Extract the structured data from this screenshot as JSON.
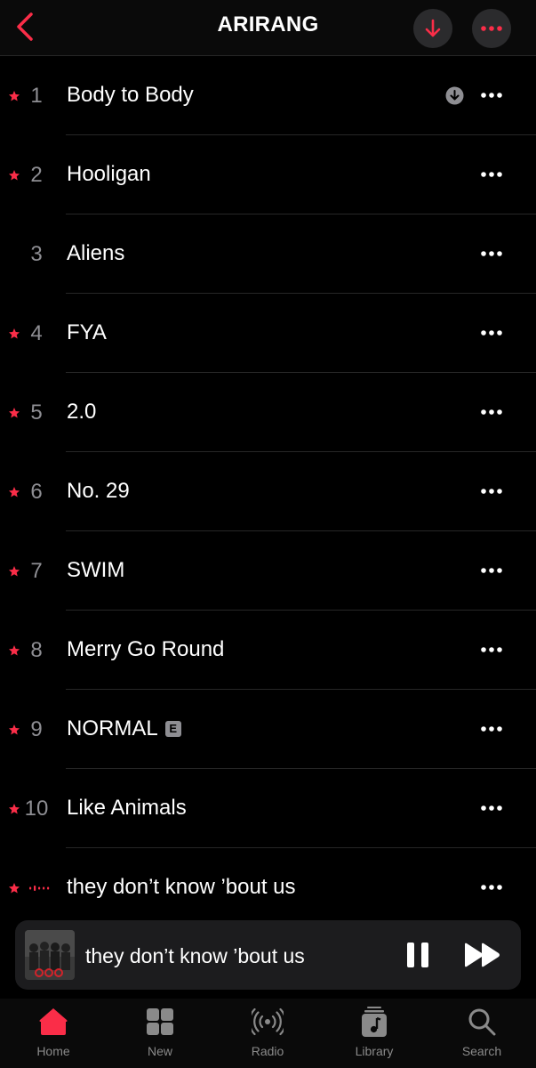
{
  "header": {
    "title": "ARIRANG",
    "back_icon": "chevron-left-icon",
    "download_icon": "arrow-down-icon",
    "more_icon": "ellipsis-icon"
  },
  "colors": {
    "accent": "#fa2d48",
    "secondary_text": "#8e8e93",
    "background": "#000000",
    "surface": "#1c1c1e"
  },
  "tracks": [
    {
      "num": "1",
      "name": "Body to Body",
      "starred": true,
      "downloaded": true,
      "explicit": false,
      "playing": false
    },
    {
      "num": "2",
      "name": "Hooligan",
      "starred": true,
      "downloaded": false,
      "explicit": false,
      "playing": false
    },
    {
      "num": "3",
      "name": "Aliens",
      "starred": false,
      "downloaded": false,
      "explicit": false,
      "playing": false
    },
    {
      "num": "4",
      "name": "FYA",
      "starred": true,
      "downloaded": false,
      "explicit": false,
      "playing": false
    },
    {
      "num": "5",
      "name": "2.0",
      "starred": true,
      "downloaded": false,
      "explicit": false,
      "playing": false
    },
    {
      "num": "6",
      "name": "No. 29",
      "starred": true,
      "downloaded": false,
      "explicit": false,
      "playing": false
    },
    {
      "num": "7",
      "name": "SWIM",
      "starred": true,
      "downloaded": false,
      "explicit": false,
      "playing": false
    },
    {
      "num": "8",
      "name": "Merry Go Round",
      "starred": true,
      "downloaded": false,
      "explicit": false,
      "playing": false
    },
    {
      "num": "9",
      "name": "NORMAL",
      "starred": true,
      "downloaded": false,
      "explicit": true,
      "playing": false
    },
    {
      "num": "10",
      "name": "Like Animals",
      "starred": true,
      "downloaded": false,
      "explicit": false,
      "playing": false
    },
    {
      "num": "",
      "name": "they don’t know ’bout us",
      "starred": true,
      "downloaded": false,
      "explicit": false,
      "playing": true
    }
  ],
  "explicit_badge": "E",
  "mini_player": {
    "title": "they don’t know ’bout us",
    "pause_icon": "pause-icon",
    "forward_icon": "fast-forward-icon"
  },
  "tabs": [
    {
      "label": "Home",
      "icon": "home-icon",
      "active": true
    },
    {
      "label": "New",
      "icon": "grid-icon",
      "active": false
    },
    {
      "label": "Radio",
      "icon": "radio-icon",
      "active": false
    },
    {
      "label": "Library",
      "icon": "library-icon",
      "active": false
    },
    {
      "label": "Search",
      "icon": "search-icon",
      "active": false
    }
  ]
}
